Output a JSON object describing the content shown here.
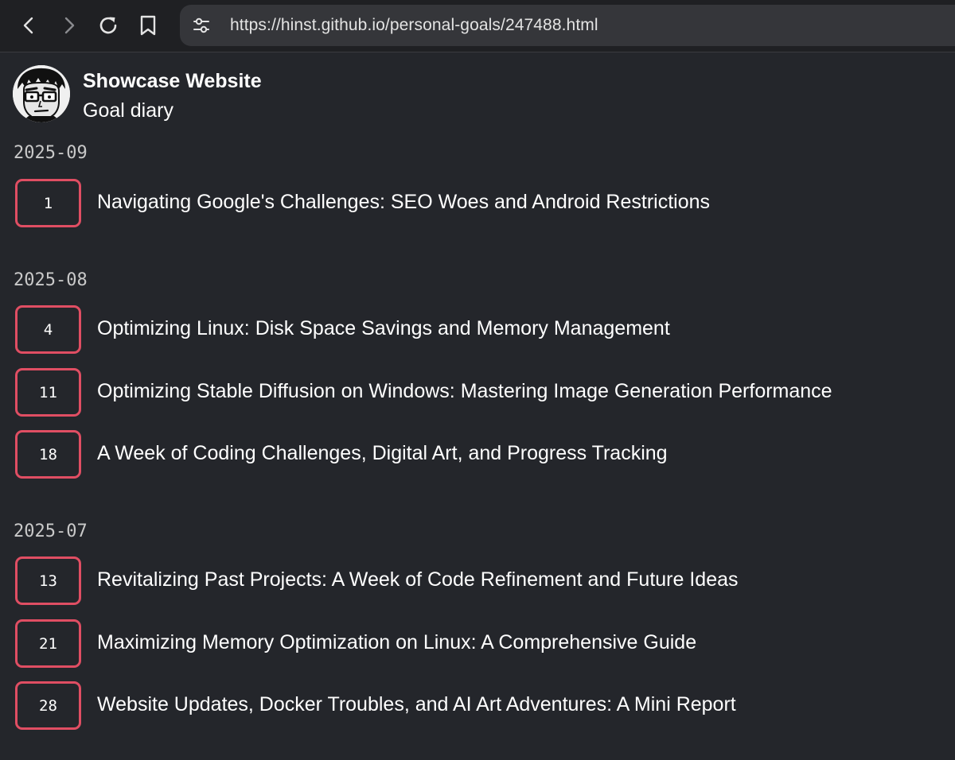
{
  "browser": {
    "url": "https://hinst.github.io/personal-goals/247488.html",
    "icons": [
      "back-icon",
      "forward-icon",
      "reload-icon",
      "bookmark-icon",
      "site-info-icon"
    ]
  },
  "header": {
    "title": "Showcase Website",
    "subtitle": "Goal diary"
  },
  "months": [
    {
      "label": "2025-09",
      "entries": [
        {
          "day": "1",
          "title": "Navigating Google's Challenges: SEO Woes and Android Restrictions"
        }
      ]
    },
    {
      "label": "2025-08",
      "entries": [
        {
          "day": "4",
          "title": "Optimizing Linux: Disk Space Savings and Memory Management"
        },
        {
          "day": "11",
          "title": "Optimizing Stable Diffusion on Windows: Mastering Image Generation Performance"
        },
        {
          "day": "18",
          "title": "A Week of Coding Challenges, Digital Art, and Progress Tracking"
        }
      ]
    },
    {
      "label": "2025-07",
      "entries": [
        {
          "day": "13",
          "title": "Revitalizing Past Projects: A Week of Code Refinement and Future Ideas"
        },
        {
          "day": "21",
          "title": "Maximizing Memory Optimization on Linux: A Comprehensive Guide"
        },
        {
          "day": "28",
          "title": "Website Updates, Docker Troubles, and AI Art Adventures: A Mini Report"
        }
      ]
    }
  ],
  "colors": {
    "background": "#24262b",
    "accent_border": "#e04e63",
    "month_label": "#c9c9c9"
  }
}
